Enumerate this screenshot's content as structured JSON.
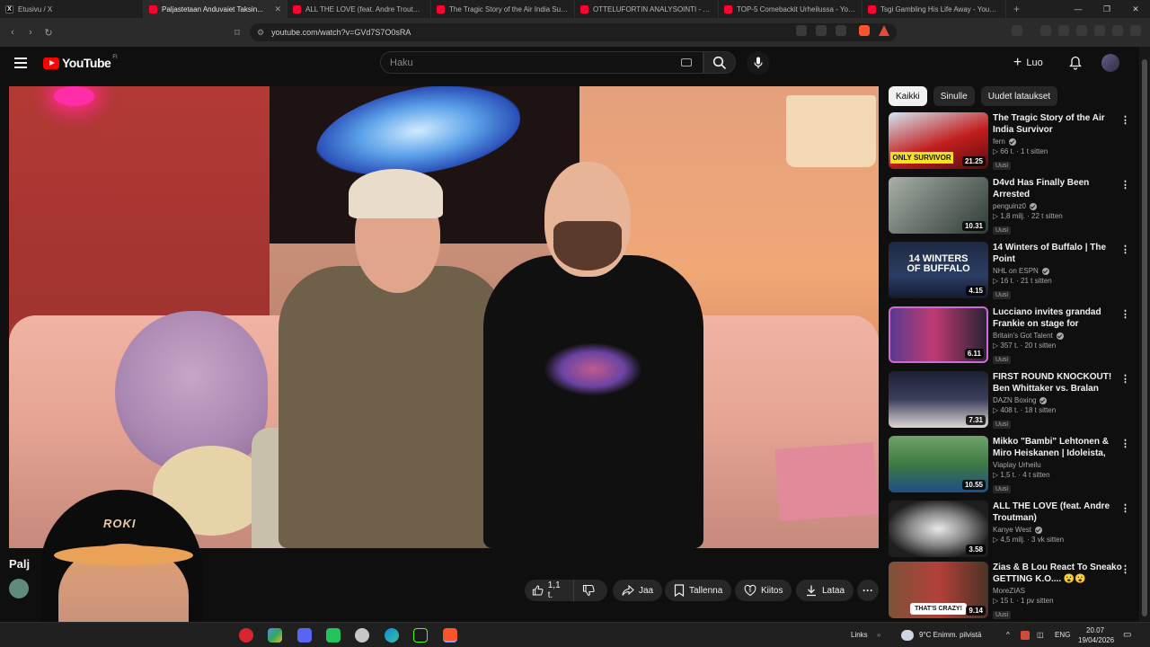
{
  "browser": {
    "tabs": [
      {
        "title": "Etusivu / X",
        "favicon": "x-icon",
        "active": false
      },
      {
        "title": "Paljastetaan Anduvaiet Taksin...",
        "favicon": "youtube-icon",
        "active": true
      },
      {
        "title": "ALL THE LOVE (feat. Andre Troutman...",
        "favicon": "youtube-icon",
        "active": false
      },
      {
        "title": "The Tragic Story of the Air India Surv...",
        "favicon": "youtube-icon",
        "active": false
      },
      {
        "title": "OTTELUFORTIN ANALYSOINTI - YouT...",
        "favicon": "youtube-icon",
        "active": false
      },
      {
        "title": "TOP-5 Comebackit Urheilussa - YouT...",
        "favicon": "youtube-icon",
        "active": false
      },
      {
        "title": "Tsgi Gambling His Life Away - YouTu...",
        "favicon": "youtube-icon",
        "active": false
      }
    ],
    "url": "youtube.com/watch?v=GVd7S7O0sRA"
  },
  "masthead": {
    "logo_text": "YouTube",
    "country_code": "FI",
    "search_placeholder": "Haku",
    "create_label": "Luo"
  },
  "video": {
    "title_fragment": "Palj",
    "likes": "1,1 t.",
    "actions": {
      "share": "Jaa",
      "save": "Tallenna",
      "thanks": "Kiitos",
      "download": "Lataa"
    },
    "webcam_cap_text": "ROKI"
  },
  "sidebar": {
    "chips": [
      "Kaikki",
      "Sinulle",
      "Uudet lataukset"
    ],
    "active_chip": "Kaikki",
    "recommendations": [
      {
        "title": "The Tragic Story of the Air India Survivor",
        "channel": "fern",
        "verified": true,
        "stats": "66 t. · 1 t sitten",
        "badge": "Uusi",
        "duration": "21.25",
        "thumb_text": "ONLY SURVIVOR",
        "has_play_prefix": true
      },
      {
        "title": "D4vd Has Finally Been Arrested",
        "channel": "penguinz0",
        "verified": true,
        "stats": "1,8 milj. · 22 t sitten",
        "badge": "Uusi",
        "duration": "10.31",
        "thumb_text": "",
        "has_play_prefix": true
      },
      {
        "title": "14 Winters of Buffalo | The Point",
        "channel": "NHL on ESPN",
        "verified": true,
        "stats": "16 t. · 21 t sitten",
        "badge": "Uusi",
        "duration": "4.15",
        "thumb_text": "14 WINTERS OF BUFFALO",
        "has_play_prefix": true
      },
      {
        "title": "Lucciano invites grandad Frankie on stage for emotiona...",
        "channel": "Britain's Got Talent",
        "verified": true,
        "stats": "357 t. · 20 t sitten",
        "badge": "Uusi",
        "duration": "6.11",
        "thumb_text": "",
        "has_play_prefix": true
      },
      {
        "title": "FIRST ROUND KNOCKOUT! Ben Whittaker vs. Bralan Suarez | ...",
        "channel": "DAZN Boxing",
        "verified": true,
        "stats": "408 t. · 18 t sitten",
        "badge": "Uusi",
        "duration": "7.31",
        "thumb_text": "",
        "has_play_prefix": true
      },
      {
        "title": "Mikko \"Bambi\" Lehtonen & Miro Heiskanen | Idoleista, urasta &...",
        "channel": "Viaplay Urheilu",
        "verified": false,
        "stats": "1,5 t. · 4 t sitten",
        "badge": "Uusi",
        "duration": "10.55",
        "thumb_text": "",
        "has_play_prefix": true
      },
      {
        "title": "ALL THE LOVE (feat. Andre Troutman)",
        "channel": "Kanye West",
        "verified": true,
        "stats": "4,5 milj. · 3 vk sitten",
        "badge": "",
        "duration": "3.58",
        "thumb_text": "",
        "has_play_prefix": true
      },
      {
        "title": "Zias & B Lou React To Sneako GETTING K.O.... 😮😮",
        "channel": "MoreZIAS",
        "verified": false,
        "stats": "15 t. · 1 pv sitten",
        "badge": "Uusi",
        "duration": "9.14",
        "thumb_text": "THAT'S CRAZY!",
        "has_play_prefix": true
      }
    ]
  },
  "taskbar": {
    "links_label": "Links",
    "weather": "9°C  Enimm. pilvistä",
    "language": "ENG",
    "time": "20.07",
    "date": "19/04/2026"
  },
  "colors": {
    "youtube_red": "#ff0000",
    "background": "#0f0f0f",
    "pill_bg": "#272727"
  }
}
